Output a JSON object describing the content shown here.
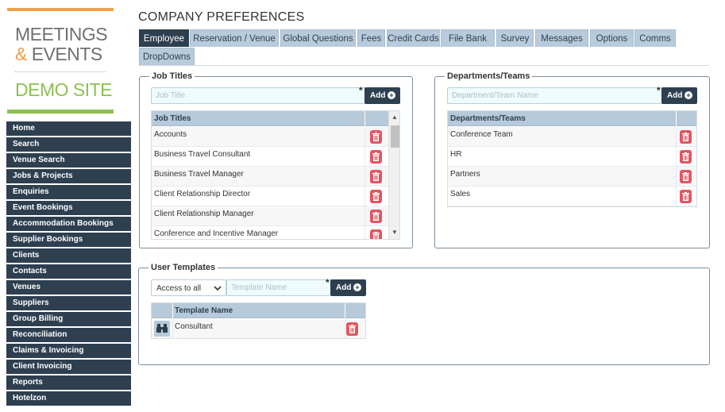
{
  "logo": {
    "line1": "MEETINGS",
    "amp": "&",
    "line2": "EVENTS",
    "line3": "DEMO SITE"
  },
  "nav": [
    "Home",
    "Search",
    "Venue Search",
    "Jobs & Projects",
    "Enquiries",
    "Event Bookings",
    "Accommodation Bookings",
    "Supplier Bookings",
    "Clients",
    "Contacts",
    "Venues",
    "Suppliers",
    "Group Billing",
    "Reconciliation",
    "Claims & Invoicing",
    "Client Invoicing",
    "Reports",
    "Hotelzon"
  ],
  "page": {
    "title": "COMPANY PREFERENCES"
  },
  "tabs": [
    "Employee",
    "Reservation / Venue",
    "Global Questions",
    "Fees",
    "Credit Cards",
    "File Bank",
    "Survey",
    "Messages",
    "Options",
    "Comms",
    "DropDowns"
  ],
  "active_tab": "Employee",
  "job_titles": {
    "legend": "Job Titles",
    "placeholder": "Job Title",
    "required_mark": "*",
    "add_label": "Add",
    "column": "Job Titles",
    "rows": [
      "Accounts",
      "Business Travel Consultant",
      "Business Travel Manager",
      "Client Relationship Director",
      "Client Relationship Manager",
      "Conference and Incentive Manager"
    ]
  },
  "departments": {
    "legend": "Departments/Teams",
    "placeholder": "Department/Team Name",
    "required_mark": "*",
    "add_label": "Add",
    "column": "Departments/Teams",
    "rows": [
      "Conference Team",
      "HR",
      "Partners",
      "Sales"
    ]
  },
  "templates": {
    "legend": "User Templates",
    "access_value": "Access to all",
    "placeholder": "Template Name",
    "required_mark": "*",
    "add_label": "Add",
    "column": "Template Name",
    "rows": [
      "Consultant"
    ]
  },
  "icons": {
    "add": "plus-circle-icon",
    "delete": "trash-icon",
    "view": "binoculars-icon",
    "select": "chevron-down-icon"
  },
  "colors": {
    "nav_bg": "#2e3f50",
    "tab_bg": "#b8cbdc",
    "delete": "#e35561",
    "logo_orange": "#f0a04b",
    "logo_green": "#8cc152"
  }
}
